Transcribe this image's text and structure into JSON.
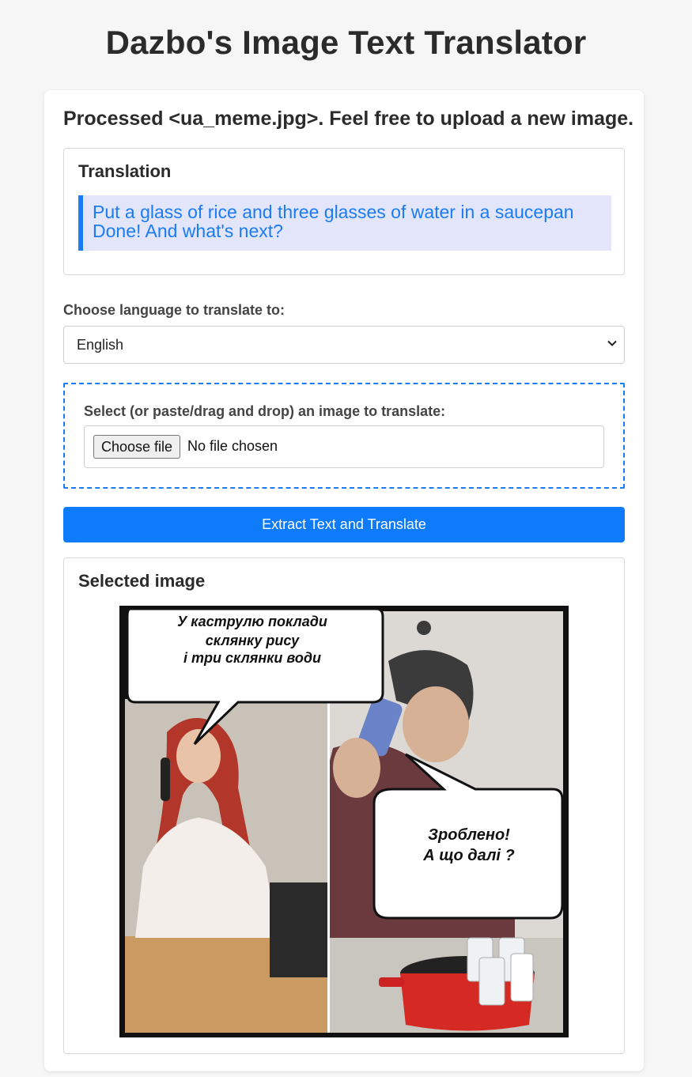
{
  "app": {
    "title": "Dazbo's Image Text Translator"
  },
  "status_message": "Processed <ua_meme.jpg>. Feel free to upload a new image.",
  "translation": {
    "heading": "Translation",
    "lines": [
      "Put a glass of rice and three glasses of water in a saucepan",
      "Done! And what's next?"
    ]
  },
  "language": {
    "label": "Choose language to translate to:",
    "selected": "English"
  },
  "upload": {
    "label": "Select (or paste/drag and drop) an image to translate:",
    "button_label": "Choose file",
    "status": "No file chosen"
  },
  "submit": {
    "label": "Extract Text and Translate"
  },
  "selected_image": {
    "heading": "Selected image",
    "bubble_top_lines": [
      "У каструлю поклади",
      "склянку рису",
      "і три склянки води"
    ],
    "bubble_bottom_lines": [
      "Зроблено!",
      "А що далі ?"
    ]
  },
  "colors": {
    "accent": "#1a7cf5",
    "button": "#0d7bfa",
    "translation_bg": "#e3e5fb"
  }
}
